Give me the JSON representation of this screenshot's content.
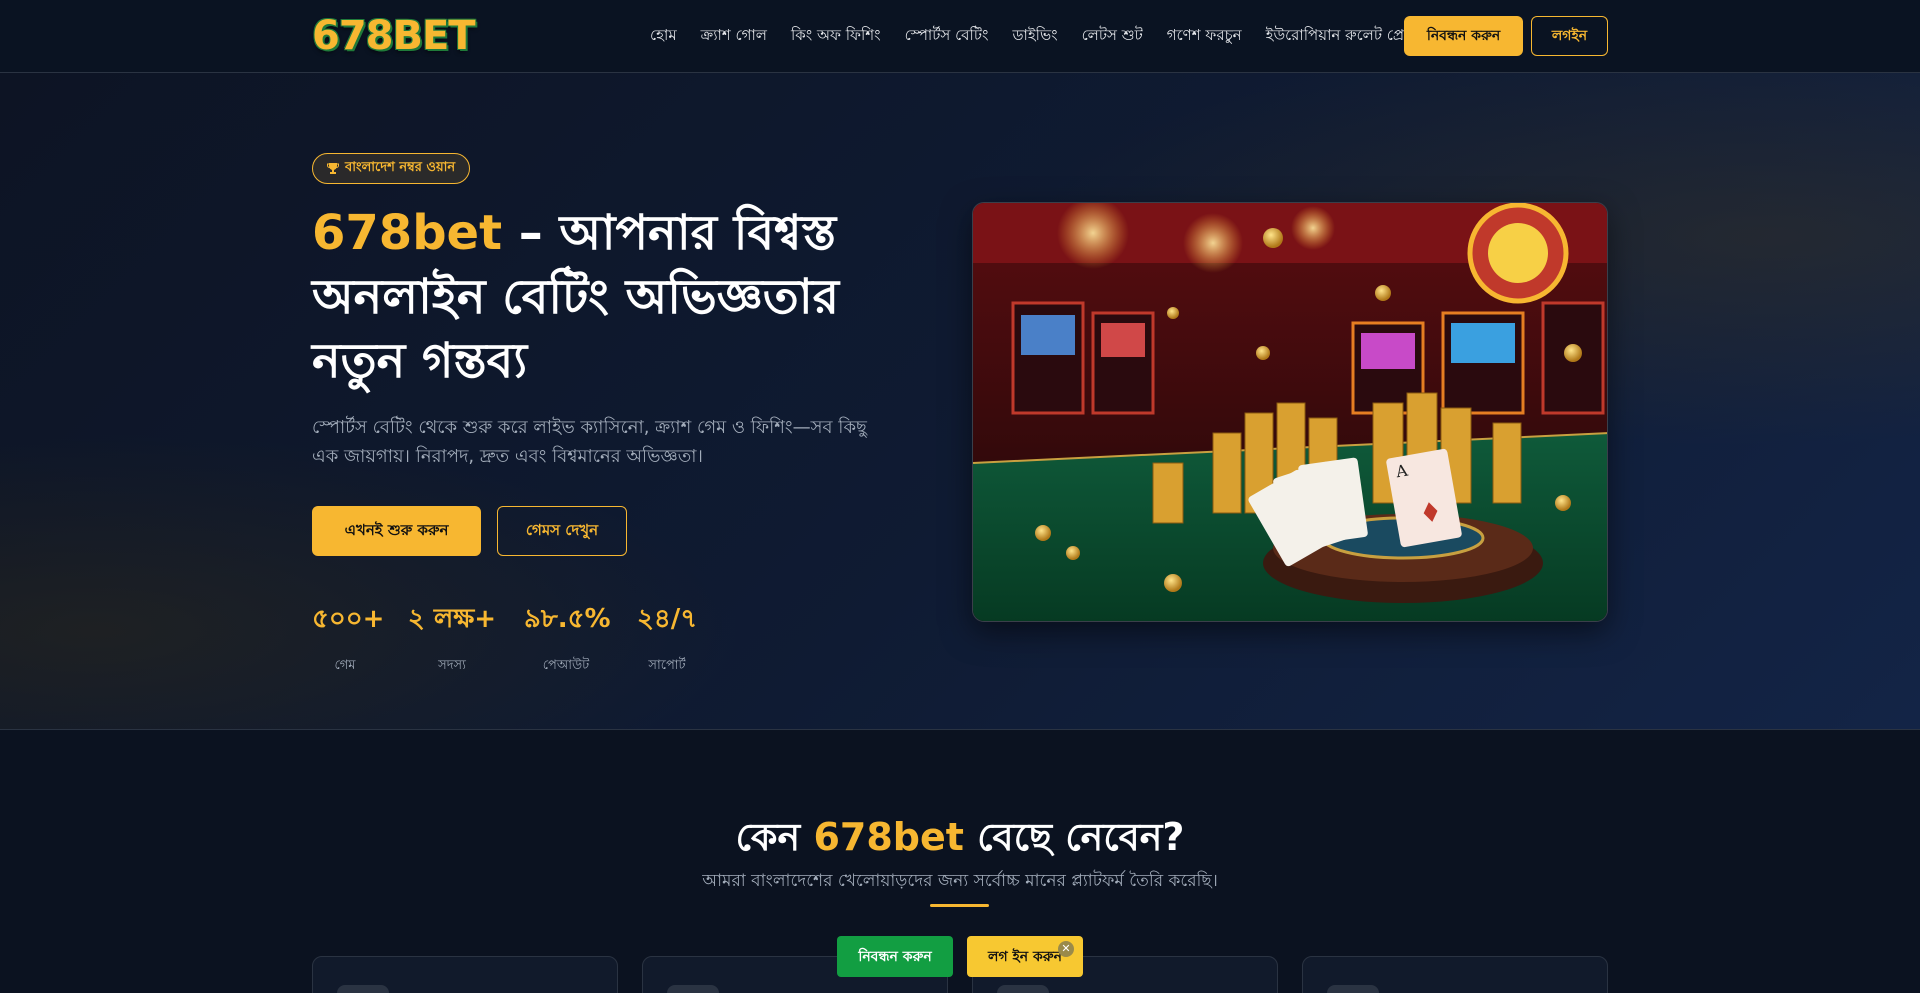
{
  "nav": {
    "logo": "678BET",
    "links": [
      "হোম",
      "ক্র্যাশ গোল",
      "কিং অফ ফিশিং",
      "স্পোর্টস বেটিং",
      "ডাইভিং",
      "লেটস শুট",
      "গণেশ ফরচুন",
      "ইউরোপিয়ান রুলেট প্রো"
    ],
    "register_label": "নিবন্ধন করুন",
    "login_label": "লগইন"
  },
  "hero": {
    "badge_icon": "trophy-icon",
    "badge_text": "বাংলাদেশ নম্বর ওয়ান",
    "title_brand": "678bet",
    "title_rest": " – আপনার বিশ্বস্ত অনলাইন বেটিং অভিজ্ঞতার নতুন গন্তব্য",
    "description": "স্পোর্টস বেটিং থেকে শুরু করে লাইভ ক্যাসিনো, ক্র্যাশ গেম ও ফিশিং—সব কিছু এক জায়গায়। নিরাপদ, দ্রুত এবং বিশ্বমানের অভিজ্ঞতা।",
    "start_label": "এখনই শুরু করুন",
    "games_label": "গেমস দেখুন",
    "stats": [
      {
        "value": "৫০০+",
        "label": "গেম"
      },
      {
        "value": "২ লক্ষ+",
        "label": "সদস্য"
      },
      {
        "value": "৯৮.৫%",
        "label": "পেআউট"
      },
      {
        "value": "২৪/৭",
        "label": "সাপোর্ট"
      }
    ]
  },
  "why": {
    "title_pre": "কেন ",
    "title_brand": "678bet",
    "title_post": " বেছে নেবেন?",
    "subtitle": "আমরা বাংলাদেশের খেলোয়াড়দের জন্য সর্বোচ্চ মানের প্ল্যাটফর্ম তৈরি করেছি।"
  },
  "sticky": {
    "register_label": "নিবন্ধন করুন",
    "login_label": "লগ ইন করুন",
    "close_icon": "close-icon"
  },
  "colors": {
    "accent": "#f7b731",
    "background": "#0b1220",
    "sticky_register": "#129e42"
  }
}
